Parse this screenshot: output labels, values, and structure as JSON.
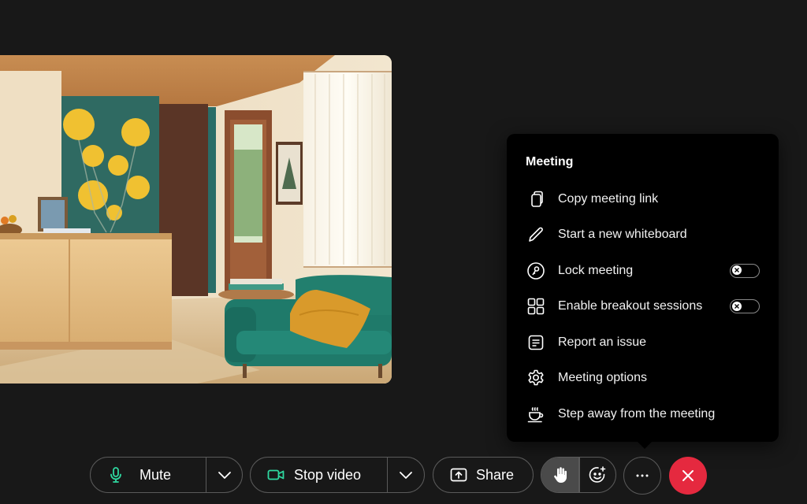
{
  "menu": {
    "title": "Meeting",
    "items": [
      {
        "label": "Copy meeting link",
        "icon": "copy-icon"
      },
      {
        "label": "Start a new whiteboard",
        "icon": "pencil-icon"
      },
      {
        "label": "Lock meeting",
        "icon": "lock-icon",
        "toggle": false
      },
      {
        "label": "Enable breakout sessions",
        "icon": "breakout-grid-icon",
        "toggle": false
      },
      {
        "label": "Report an issue",
        "icon": "report-icon"
      },
      {
        "label": "Meeting options",
        "icon": "gear-icon"
      },
      {
        "label": "Step away from the meeting",
        "icon": "coffee-cup-icon"
      }
    ]
  },
  "controls": {
    "mute_label": "Mute",
    "video_label": "Stop video",
    "share_label": "Share"
  },
  "colors": {
    "accent_green": "#2fd8a0",
    "end_call_red": "#e5293f",
    "background": "#181818",
    "menu_bg": "#000000"
  }
}
